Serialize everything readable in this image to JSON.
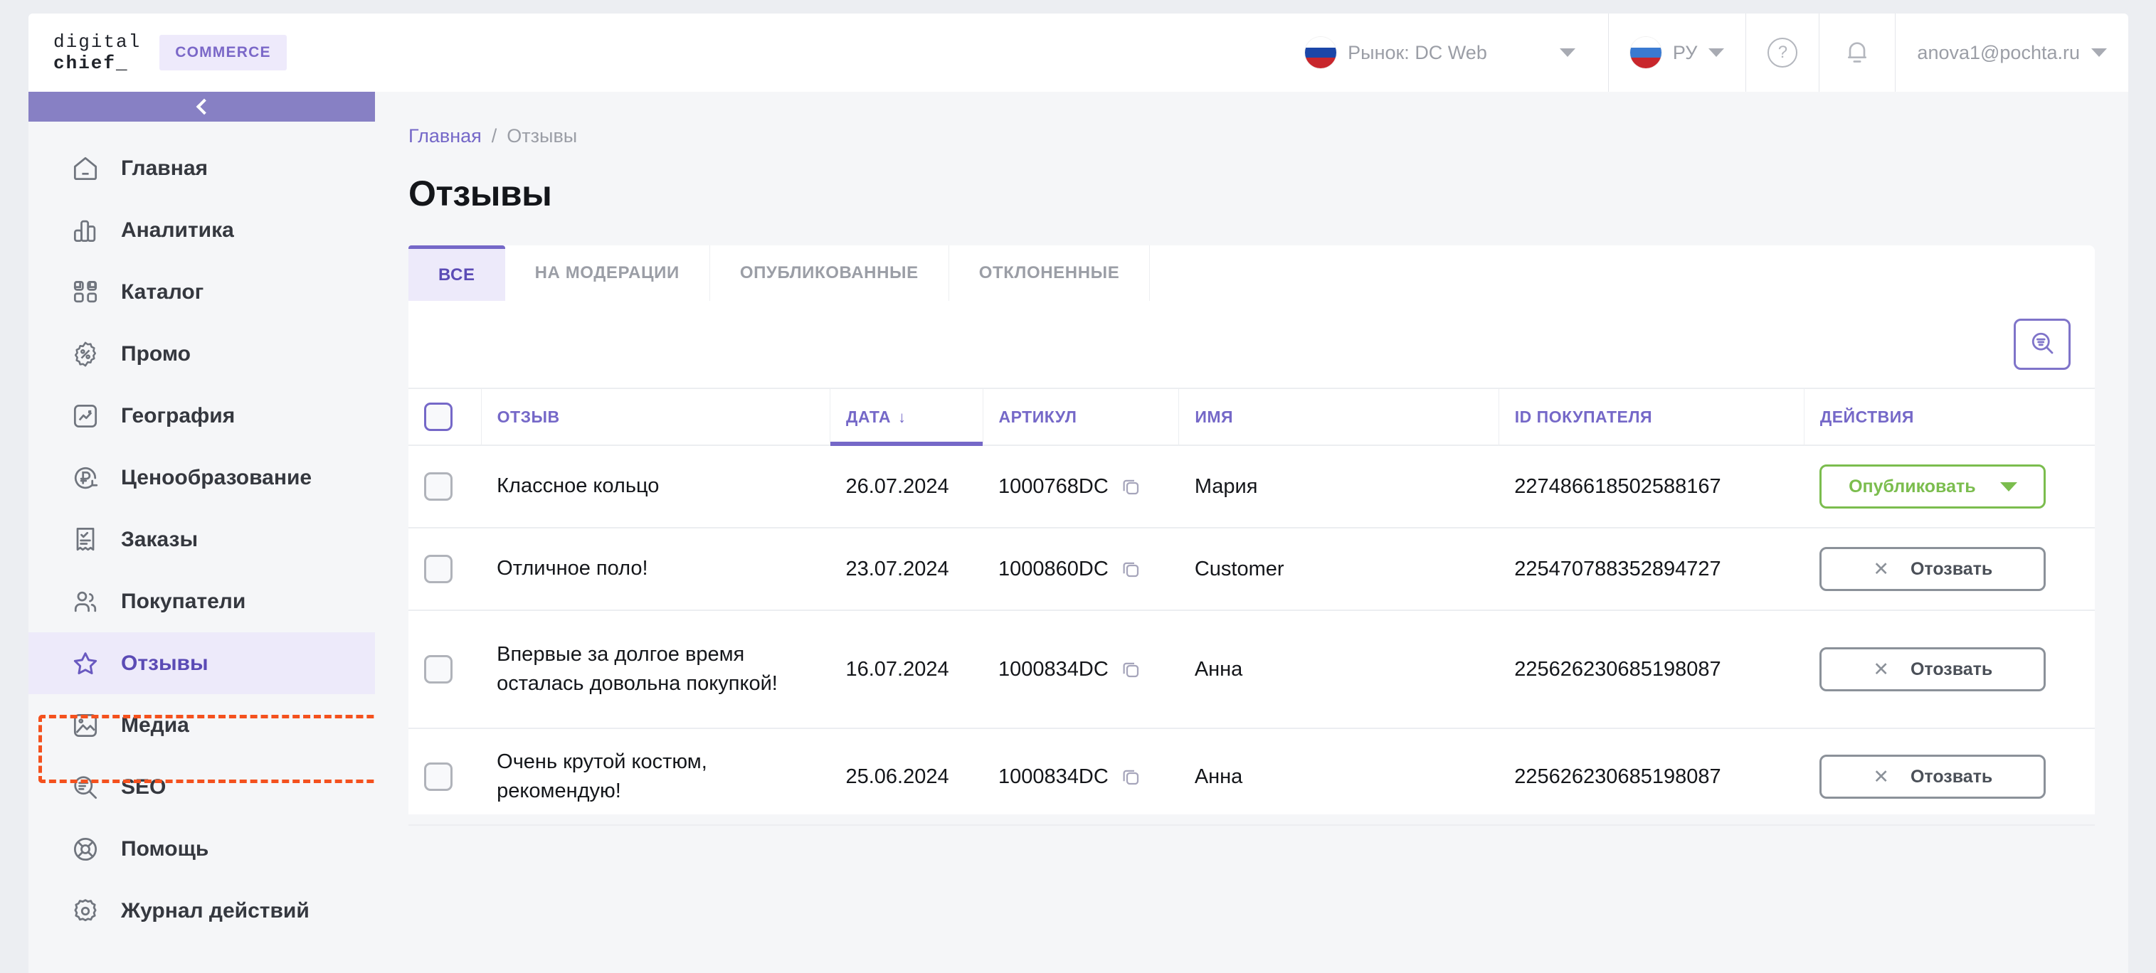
{
  "header": {
    "logo_line1": "digital",
    "logo_line2": "chief_",
    "commerce_badge": "COMMERCE",
    "market_label": "Рынок: DC Web",
    "language_label": "РУ",
    "help_glyph": "?",
    "user_email": "anova1@pochta.ru"
  },
  "sidebar": {
    "collapse_label": "<",
    "items": [
      {
        "label": "Главная",
        "icon": "home-icon"
      },
      {
        "label": "Аналитика",
        "icon": "bar-chart-icon"
      },
      {
        "label": "Каталог",
        "icon": "grid-icon"
      },
      {
        "label": "Промо",
        "icon": "percent-badge-icon"
      },
      {
        "label": "География",
        "icon": "chart-square-icon"
      },
      {
        "label": "Ценообразование",
        "icon": "ruble-refresh-icon"
      },
      {
        "label": "Заказы",
        "icon": "receipt-check-icon"
      },
      {
        "label": "Покупатели",
        "icon": "users-icon"
      },
      {
        "label": "Отзывы",
        "icon": "star-icon"
      },
      {
        "label": "Медиа",
        "icon": "image-icon"
      },
      {
        "label": "SEO",
        "icon": "search-lines-icon"
      },
      {
        "label": "Помощь",
        "icon": "lifebuoy-icon"
      },
      {
        "label": "Журнал действий",
        "icon": "gear-icon"
      }
    ],
    "active_item": "Отзывы"
  },
  "breadcrumb": {
    "home": "Главная",
    "separator": "/",
    "current": "Отзывы"
  },
  "page_title": "Отзывы",
  "tabs": [
    {
      "label": "ВСЕ",
      "active": true
    },
    {
      "label": "НА МОДЕРАЦИИ",
      "active": false
    },
    {
      "label": "ОПУБЛИКОВАННЫЕ",
      "active": false
    },
    {
      "label": "ОТКЛОНЕННЫЕ",
      "active": false
    }
  ],
  "toolbar": {
    "filter_icon": "search-filter-icon"
  },
  "table": {
    "columns": {
      "review": "ОТЗЫВ",
      "date": "ДАТА",
      "date_sort_arrow": "↓",
      "article": "АРТИКУЛ",
      "name": "ИМЯ",
      "customer_id": "ID ПОКУПАТЕЛЯ",
      "actions": "ДЕЙСТВИЯ"
    },
    "rows": [
      {
        "review": "Классное кольцо",
        "date": "26.07.2024",
        "article": "1000768DC",
        "name": "Мария",
        "customer_id": "227486618502588167",
        "action_label": "Опубликовать",
        "action_type": "publish"
      },
      {
        "review": "Отличное поло!",
        "date": "23.07.2024",
        "article": "1000860DC",
        "name": "Customer",
        "customer_id": "225470788352894727",
        "action_label": "Отозвать",
        "action_type": "revoke"
      },
      {
        "review": "Впервые за долгое время осталась довольна покупкой!",
        "date": "16.07.2024",
        "article": "1000834DC",
        "name": "Анна",
        "customer_id": "225626230685198087",
        "action_label": "Отозвать",
        "action_type": "revoke"
      },
      {
        "review": "Очень крутой костюм, рекомендую!",
        "date": "25.06.2024",
        "article": "1000834DC",
        "name": "Анна",
        "customer_id": "225626230685198087",
        "action_label": "Отозвать",
        "action_type": "revoke"
      }
    ]
  },
  "colors": {
    "accent": "#7568c8",
    "accent_dark": "#5b4bb5",
    "accent_light_bg": "#edeafa",
    "publish_green": "#7bbd4e",
    "revoke_gray": "#8b9199",
    "annotation_orange": "#f4511e",
    "page_bg": "#eceef2",
    "panel_bg": "#f5f6f8"
  }
}
